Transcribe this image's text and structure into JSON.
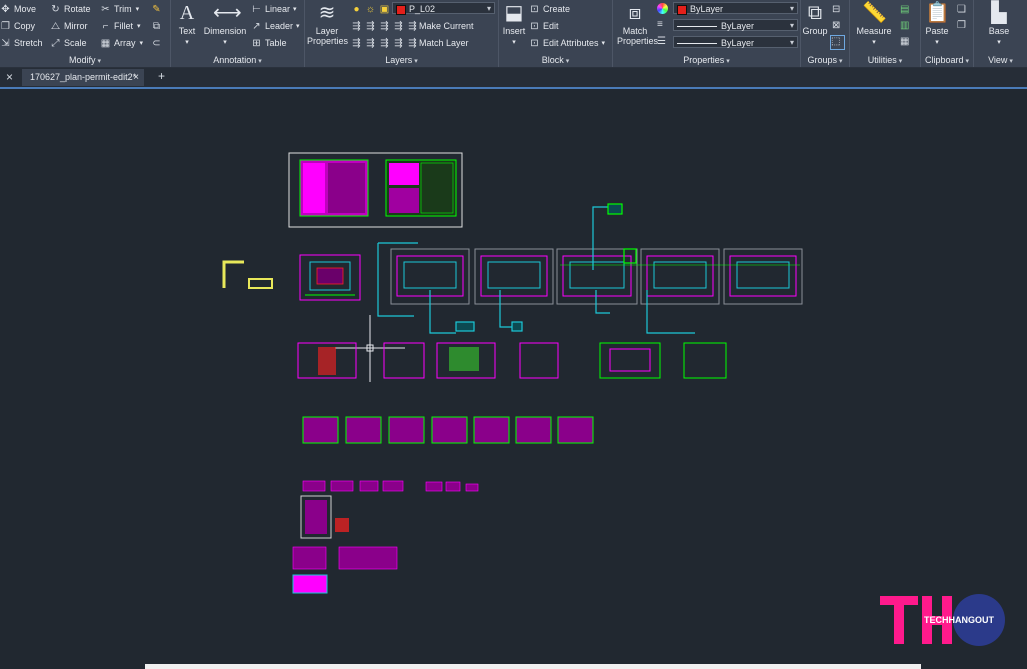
{
  "ribbon": {
    "modify": {
      "title": "Modify",
      "items": [
        "Move",
        "Rotate",
        "Trim",
        "Copy",
        "Mirror",
        "Fillet",
        "Stretch",
        "Scale",
        "Array"
      ]
    },
    "annotation": {
      "title": "Annotation",
      "text": "Text",
      "dimension": "Dimension",
      "linear": "Linear",
      "leader": "Leader",
      "table": "Table"
    },
    "layers": {
      "title": "Layers",
      "layer_properties": "Layer Properties",
      "current_layer": "P_L02",
      "make_current": "Make Current",
      "match_layer": "Match Layer"
    },
    "block": {
      "title": "Block",
      "insert": "Insert",
      "create": "Create",
      "edit": "Edit",
      "edit_attributes": "Edit Attributes"
    },
    "properties": {
      "title": "Properties",
      "match_properties": "Match Properties",
      "color": "ByLayer",
      "linetype": "ByLayer",
      "lineweight": "ByLayer"
    },
    "groups": {
      "title": "Groups",
      "group": "Group"
    },
    "utilities": {
      "title": "Utilities",
      "measure": "Measure"
    },
    "clipboard": {
      "title": "Clipboard",
      "paste": "Paste"
    },
    "view": {
      "title": "View",
      "base": "Base"
    }
  },
  "tabs": {
    "close_icon": "×",
    "document": "170627_plan-permit-edit2*",
    "add": "+"
  },
  "colors": {
    "canvas": "#212830",
    "magenta": "#ff00ff",
    "green": "#00ff00",
    "cyan": "#1cc7d8",
    "yellow": "#e8e85a",
    "red": "#ff2020"
  },
  "watermark": {
    "text": "TECHHANGOUT"
  }
}
